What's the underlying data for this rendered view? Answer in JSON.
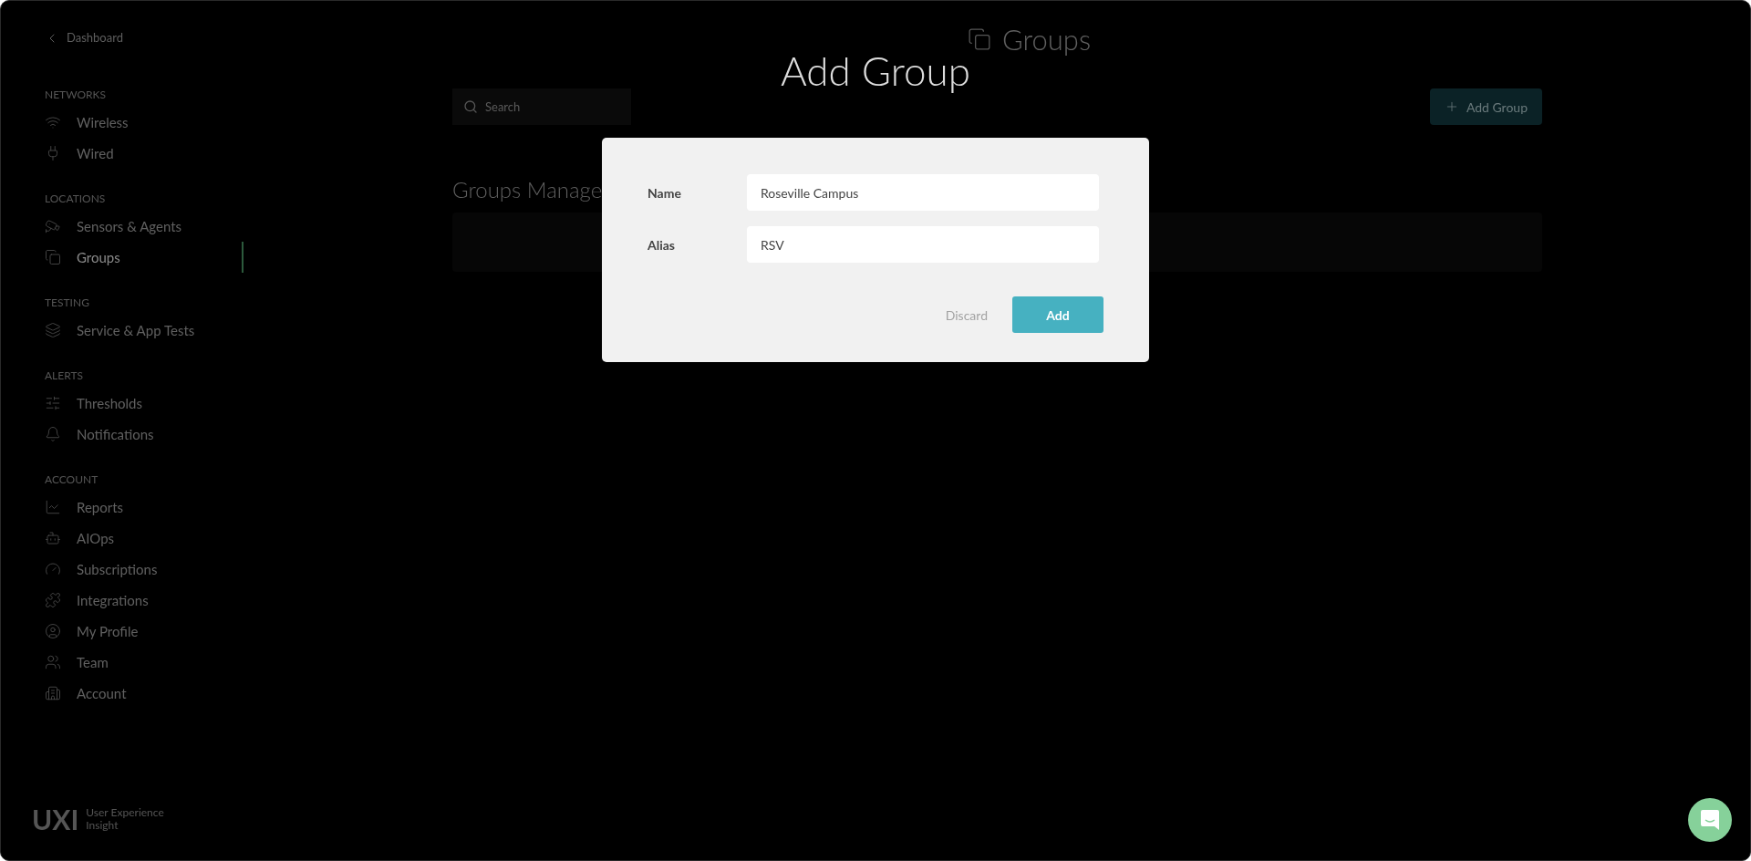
{
  "sidebar": {
    "back_link": "Dashboard",
    "sections": [
      {
        "heading": "NETWORKS",
        "items": [
          {
            "label": "Wireless",
            "selected": false
          },
          {
            "label": "Wired",
            "selected": false
          }
        ]
      },
      {
        "heading": "LOCATIONS",
        "items": [
          {
            "label": "Sensors & Agents",
            "selected": false
          },
          {
            "label": "Groups",
            "selected": true
          }
        ]
      },
      {
        "heading": "TESTING",
        "items": [
          {
            "label": "Service & App Tests",
            "selected": false
          }
        ]
      },
      {
        "heading": "ALERTS",
        "items": [
          {
            "label": "Thresholds",
            "selected": false
          },
          {
            "label": "Notifications",
            "selected": false
          }
        ]
      },
      {
        "heading": "ACCOUNT",
        "items": [
          {
            "label": "Reports",
            "selected": false
          },
          {
            "label": "AIOps",
            "selected": false
          },
          {
            "label": "Subscriptions",
            "selected": false
          },
          {
            "label": "Integrations",
            "selected": false
          },
          {
            "label": "My Profile",
            "selected": false
          },
          {
            "label": "Team",
            "selected": false
          },
          {
            "label": "Account",
            "selected": false
          }
        ]
      }
    ],
    "logo": {
      "mark": "UXI",
      "tagline": [
        "User Experience",
        "Insight"
      ]
    }
  },
  "page": {
    "title": "Groups",
    "search": {
      "placeholder": "Search"
    },
    "add_button": "Add Group",
    "section_title": "Groups Manage"
  },
  "dialog": {
    "title": "Add Group",
    "fields": [
      {
        "label": "Name",
        "value": "Roseville Campus"
      },
      {
        "label": "Alias",
        "value": "RSV"
      }
    ],
    "buttons": [
      {
        "kind": "secondary",
        "label": "Discard"
      },
      {
        "kind": "primary",
        "label": "Add"
      }
    ]
  }
}
